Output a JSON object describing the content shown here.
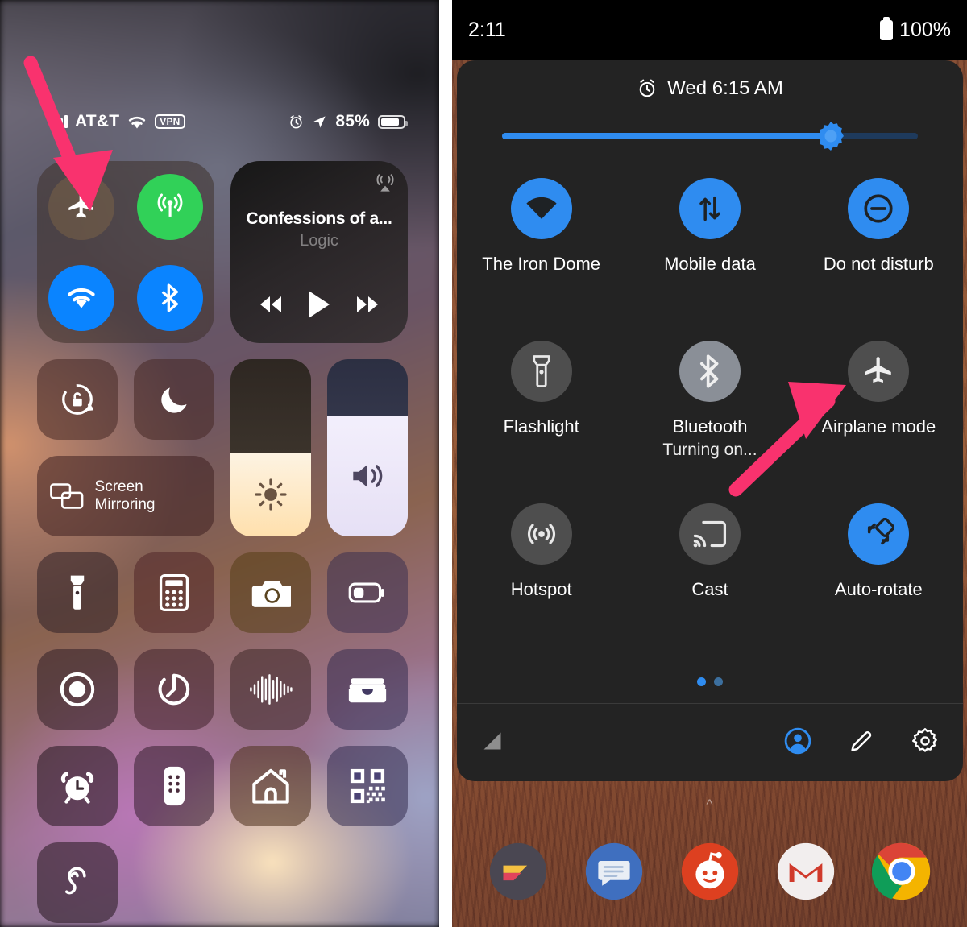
{
  "ios": {
    "status_bar": {
      "carrier": "AT&T",
      "vpn_badge": "VPN",
      "battery_percent": "85%",
      "signal_icon": "cellular-bars-icon",
      "wifi_icon": "wifi-icon",
      "alarm_icon": "alarm-clock-icon",
      "location_icon": "location-arrow-icon",
      "battery_icon": "battery-icon"
    },
    "connectivity": {
      "airplane": {
        "name": "airplane-mode-toggle",
        "state": "off",
        "icon": "airplane-icon"
      },
      "cellular": {
        "name": "cellular-data-toggle",
        "state": "on",
        "color": "#31d158",
        "icon": "cellular-antenna-icon"
      },
      "wifi": {
        "name": "wifi-toggle",
        "state": "on",
        "color": "#0a84ff",
        "icon": "wifi-icon"
      },
      "bluetooth": {
        "name": "bluetooth-toggle",
        "state": "on",
        "color": "#0a84ff",
        "icon": "bluetooth-icon"
      }
    },
    "media": {
      "title": "Confessions of a...",
      "artist": "Logic",
      "airplay_icon": "airplay-audio-icon",
      "rewind_icon": "rewind-icon",
      "play_icon": "play-icon",
      "forward_icon": "fast-forward-icon"
    },
    "toggles": {
      "rotation_lock": "rotation-lock-icon",
      "do_not_disturb": "moon-icon",
      "screen_mirroring_label": "Screen Mirroring",
      "screen_mirroring_icon": "screen-mirroring-icon",
      "brightness_icon": "brightness-sun-icon",
      "volume_icon": "volume-speaker-icon",
      "brightness_level": 47,
      "volume_level": 68
    },
    "shortcuts": [
      {
        "name": "flashlight-shortcut",
        "icon": "flashlight-icon"
      },
      {
        "name": "calculator-shortcut",
        "icon": "calculator-icon"
      },
      {
        "name": "camera-shortcut",
        "icon": "camera-icon"
      },
      {
        "name": "low-power-mode-shortcut",
        "icon": "low-battery-icon"
      },
      {
        "name": "screen-record-shortcut",
        "icon": "record-circle-icon"
      },
      {
        "name": "timer-shortcut",
        "icon": "timer-icon"
      },
      {
        "name": "voice-memos-shortcut",
        "icon": "waveform-icon"
      },
      {
        "name": "wallet-shortcut",
        "icon": "wallet-icon"
      },
      {
        "name": "alarm-shortcut",
        "icon": "alarm-clock-icon"
      },
      {
        "name": "apple-tv-remote-shortcut",
        "icon": "remote-control-icon"
      },
      {
        "name": "home-shortcut",
        "icon": "home-icon"
      },
      {
        "name": "qr-scanner-shortcut",
        "icon": "qr-code-icon"
      },
      {
        "name": "hearing-shortcut",
        "icon": "ear-icon"
      }
    ]
  },
  "android": {
    "status_bar": {
      "time": "2:11",
      "battery_percent": "100%",
      "battery_icon": "battery-full-icon"
    },
    "quick_settings": {
      "alarm_text": "Wed 6:15 AM",
      "alarm_icon": "alarm-clock-icon",
      "brightness_level": 79,
      "brightness_icon": "brightness-sun-icon",
      "tiles": [
        {
          "label": "The Iron Dome",
          "sub": "",
          "state": "on",
          "icon": "wifi-icon",
          "name": "tile-wifi"
        },
        {
          "label": "Mobile data",
          "sub": "",
          "state": "on",
          "icon": "mobile-data-icon",
          "name": "tile-mobile-data"
        },
        {
          "label": "Do not disturb",
          "sub": "",
          "state": "on",
          "icon": "do-not-disturb-icon",
          "name": "tile-do-not-disturb"
        },
        {
          "label": "Flashlight",
          "sub": "",
          "state": "off",
          "icon": "flashlight-icon",
          "name": "tile-flashlight"
        },
        {
          "label": "Bluetooth",
          "sub": "Turning on...",
          "state": "pending",
          "icon": "bluetooth-icon",
          "name": "tile-bluetooth"
        },
        {
          "label": "Airplane mode",
          "sub": "",
          "state": "off",
          "icon": "airplane-icon",
          "name": "tile-airplane-mode"
        },
        {
          "label": "Hotspot",
          "sub": "",
          "state": "off",
          "icon": "hotspot-icon",
          "name": "tile-hotspot"
        },
        {
          "label": "Cast",
          "sub": "",
          "state": "off",
          "icon": "cast-icon",
          "name": "tile-cast"
        },
        {
          "label": "Auto-rotate",
          "sub": "",
          "state": "on",
          "icon": "auto-rotate-icon",
          "name": "tile-auto-rotate"
        }
      ],
      "page_dots": {
        "total": 2,
        "active": 1
      },
      "footer": {
        "signal_icon": "signal-triangle-icon",
        "user_icon": "user-account-icon",
        "edit_icon": "pencil-edit-icon",
        "settings_icon": "gear-settings-icon"
      }
    },
    "dock": [
      {
        "name": "app-pushbullet",
        "icon": "feather-app-icon"
      },
      {
        "name": "app-messages",
        "icon": "messages-icon"
      },
      {
        "name": "app-reddit",
        "icon": "reddit-icon"
      },
      {
        "name": "app-gmail",
        "icon": "gmail-icon"
      },
      {
        "name": "app-chrome",
        "icon": "chrome-icon"
      }
    ],
    "home_handle_icon": "chevron-up-icon"
  },
  "annotations": {
    "arrow_color": "#f9326e",
    "arrows": [
      {
        "name": "arrow-pointing-ios-airplane-mode",
        "target": "ios airplane mode toggle"
      },
      {
        "name": "arrow-pointing-android-airplane-mode",
        "target": "android airplane mode tile"
      }
    ]
  }
}
